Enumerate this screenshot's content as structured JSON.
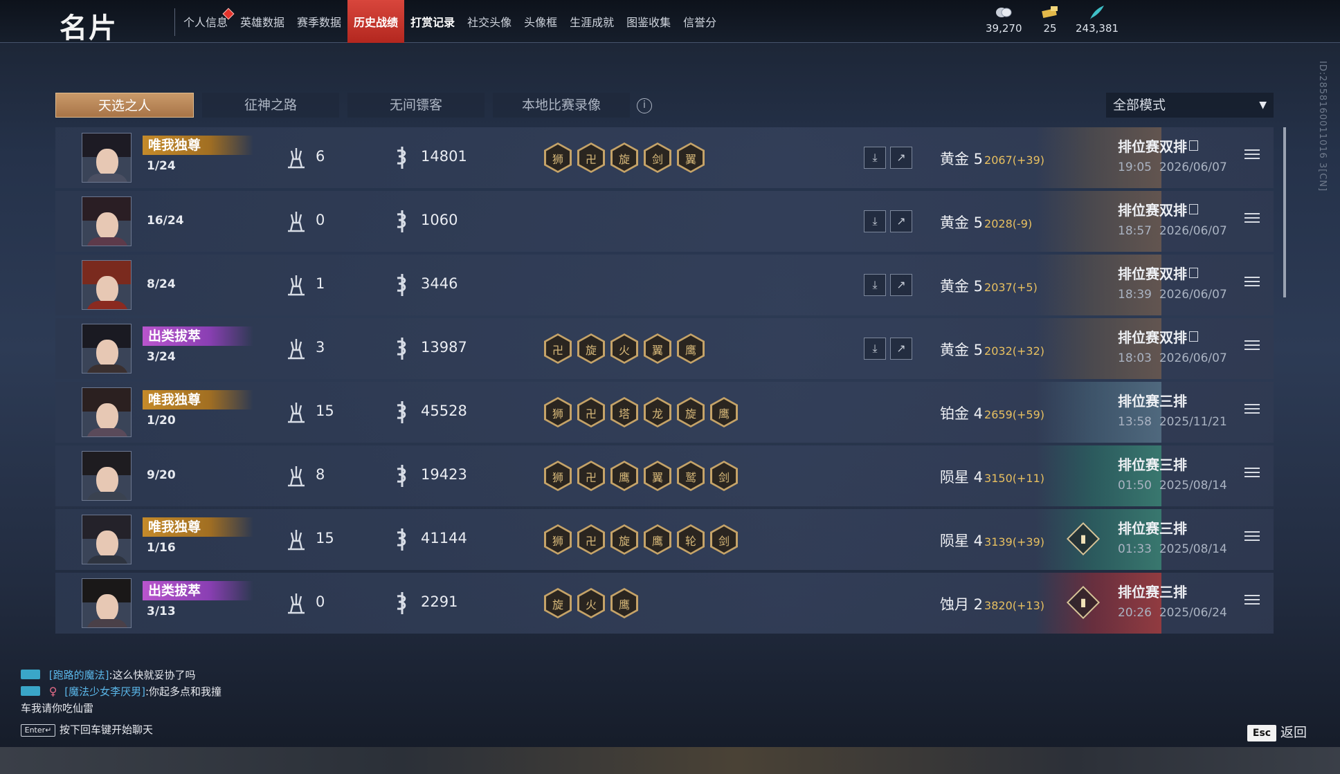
{
  "header": {
    "title": "名片",
    "tabs": [
      {
        "label": "个人信息",
        "notify": true
      },
      {
        "label": "英雄数据"
      },
      {
        "label": "赛季数据"
      },
      {
        "label": "历史战绩",
        "active": true
      },
      {
        "label": "打赏记录",
        "bold": true
      },
      {
        "label": "社交头像"
      },
      {
        "label": "头像框"
      },
      {
        "label": "生涯成就"
      },
      {
        "label": "图鉴收集"
      },
      {
        "label": "信誉分"
      }
    ],
    "currencies": [
      {
        "icon": "coins-icon",
        "value": "39,270"
      },
      {
        "icon": "ticket-icon",
        "value": "25"
      },
      {
        "icon": "feather-icon",
        "value": "243,381"
      }
    ]
  },
  "sub_tabs": [
    "天选之人",
    "征神之路",
    "无间镖客",
    "本地比赛录像"
  ],
  "mode_filter": {
    "value": "全部模式"
  },
  "player_id": "ID:2858160011016 3[CN]",
  "matches": [
    {
      "badge": "唯我独尊",
      "badge_type": "gold",
      "placement": "1/24",
      "kills": "6",
      "damage": "14801",
      "achievements": [
        "狮",
        "卍",
        "旋",
        "剑",
        "翼"
      ],
      "has_actions": true,
      "tier": "黄金 5",
      "score": "2067(+39)",
      "art": "gold",
      "mode": "排位赛双排",
      "mode_tag": true,
      "time": "19:05",
      "date": "2026/06/07"
    },
    {
      "badge": "",
      "badge_type": "",
      "placement": "16/24",
      "kills": "0",
      "damage": "1060",
      "achievements": [],
      "has_actions": true,
      "tier": "黄金 5",
      "score": "2028(-9)",
      "art": "gold",
      "mode": "排位赛双排",
      "mode_tag": true,
      "time": "18:57",
      "date": "2026/06/07"
    },
    {
      "badge": "",
      "badge_type": "",
      "placement": "8/24",
      "kills": "1",
      "damage": "3446",
      "achievements": [],
      "has_actions": true,
      "tier": "黄金 5",
      "score": "2037(+5)",
      "art": "gold",
      "mode": "排位赛双排",
      "mode_tag": true,
      "time": "18:39",
      "date": "2026/06/07"
    },
    {
      "badge": "出类拔萃",
      "badge_type": "purple",
      "placement": "3/24",
      "kills": "3",
      "damage": "13987",
      "achievements": [
        "卍",
        "旋",
        "火",
        "翼",
        "鹰"
      ],
      "has_actions": true,
      "tier": "黄金 5",
      "score": "2032(+32)",
      "art": "gold",
      "mode": "排位赛双排",
      "mode_tag": true,
      "time": "18:03",
      "date": "2026/06/07"
    },
    {
      "badge": "唯我独尊",
      "badge_type": "gold",
      "placement": "1/20",
      "kills": "15",
      "damage": "45528",
      "achievements": [
        "狮",
        "卍",
        "塔",
        "龙",
        "旋",
        "鹰"
      ],
      "has_actions": false,
      "tier": "铂金 4",
      "score": "2659(+59)",
      "art": "plat",
      "mode": "排位赛三排",
      "mode_tag": false,
      "time": "13:58",
      "date": "2025/11/21"
    },
    {
      "badge": "",
      "badge_type": "",
      "placement": "9/20",
      "kills": "8",
      "damage": "19423",
      "achievements": [
        "狮",
        "卍",
        "鹰",
        "翼",
        "鹫",
        "剑"
      ],
      "has_actions": false,
      "tier": "陨星 4",
      "score": "3150(+11)",
      "art": "meteor",
      "mode": "排位赛三排",
      "mode_tag": false,
      "time": "01:50",
      "date": "2025/08/14"
    },
    {
      "badge": "唯我独尊",
      "badge_type": "gold",
      "placement": "1/16",
      "kills": "15",
      "damage": "41144",
      "achievements": [
        "狮",
        "卍",
        "旋",
        "鹰",
        "轮",
        "剑"
      ],
      "has_actions": false,
      "stats_icon": true,
      "tier": "陨星 4",
      "score": "3139(+39)",
      "art": "meteor",
      "mode": "排位赛三排",
      "mode_tag": false,
      "time": "01:33",
      "date": "2025/08/14"
    },
    {
      "badge": "出类拔萃",
      "badge_type": "purple",
      "placement": "3/13",
      "kills": "0",
      "damage": "2291",
      "achievements": [
        "旋",
        "火",
        "鹰"
      ],
      "has_actions": false,
      "stats_icon": true,
      "tier": "蚀月 2",
      "score": "3820(+13)",
      "art": "moon",
      "mode": "排位赛三排",
      "mode_tag": false,
      "time": "20:26",
      "date": "2025/06/24"
    }
  ],
  "chat": {
    "lines": [
      {
        "name": "[跑路的魔法]",
        "text": ":这么快就妥协了吗",
        "female": false
      },
      {
        "name": "[魔法少女李厌男]",
        "text": ":你起多点和我撞",
        "female": true
      }
    ],
    "continuation": "车我请你吃仙雷",
    "enter_key": "Enter↵",
    "hint": "按下回车键开始聊天"
  },
  "footer": {
    "esc_key": "Esc",
    "back_label": "返回"
  },
  "colors": {
    "accent_red": "#c8342b",
    "tab_active": "#b8845a",
    "gold_badge": "#c48a2a",
    "purple_badge": "#b955cd",
    "score_gold": "#e8c060"
  }
}
